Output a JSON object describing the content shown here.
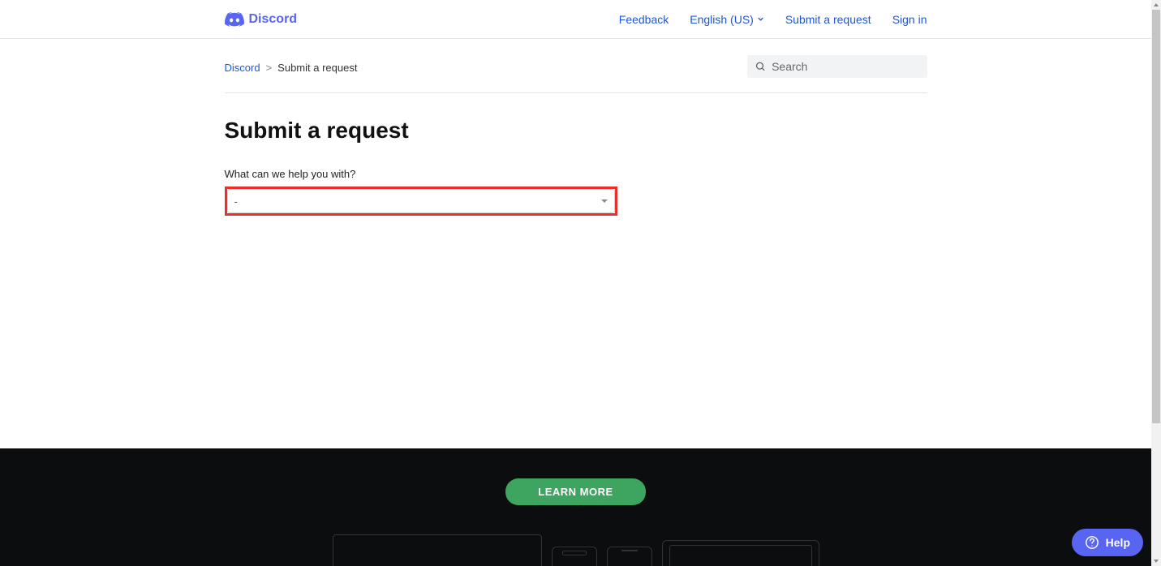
{
  "header": {
    "brand": "Discord",
    "nav": {
      "feedback": "Feedback",
      "language": "English (US)",
      "submit": "Submit a request",
      "signin": "Sign in"
    }
  },
  "breadcrumb": {
    "root": "Discord",
    "separator": ">",
    "current": "Submit a request"
  },
  "search": {
    "placeholder": "Search"
  },
  "page": {
    "title": "Submit a request"
  },
  "form": {
    "help_label": "What can we help you with?",
    "select_value": "-"
  },
  "footer": {
    "learn_more": "LEARN MORE"
  },
  "help_widget": {
    "label": "Help"
  }
}
